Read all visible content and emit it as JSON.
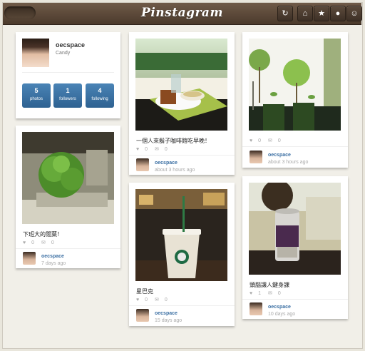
{
  "header": {
    "logo": "Pinstagram",
    "nav_icons": [
      "refresh-icon",
      "home-icon",
      "star-icon",
      "pin-icon",
      "user-icon"
    ],
    "colors": {
      "bar": "#5a4636",
      "accent": "#3b6fa3"
    }
  },
  "profile": {
    "username": "oecspace",
    "display_name": "Candy",
    "stats": [
      {
        "count": "5",
        "label": "photos"
      },
      {
        "count": "1",
        "label": "followers"
      },
      {
        "count": "4",
        "label": "following"
      }
    ]
  },
  "posts": [
    {
      "caption": "一個人來鬍子咖啡館吃早晚！",
      "likes": "0",
      "comments": "0",
      "user": "oecspace",
      "time": "about 3 hours ago"
    },
    {
      "caption": "",
      "likes": "0",
      "comments": "0",
      "user": "oecspace",
      "time": "about 3 hours ago"
    },
    {
      "caption": "下班大的闊葉！",
      "likes": "0",
      "comments": "0",
      "user": "oecspace",
      "time": "7 days ago"
    },
    {
      "caption": "星巴克",
      "likes": "0",
      "comments": "0",
      "user": "oecspace",
      "time": "15 days ago"
    },
    {
      "caption": "頭腦讓人鍵身課",
      "likes": "1",
      "comments": "0",
      "user": "oecspace",
      "time": "10 days ago"
    }
  ]
}
